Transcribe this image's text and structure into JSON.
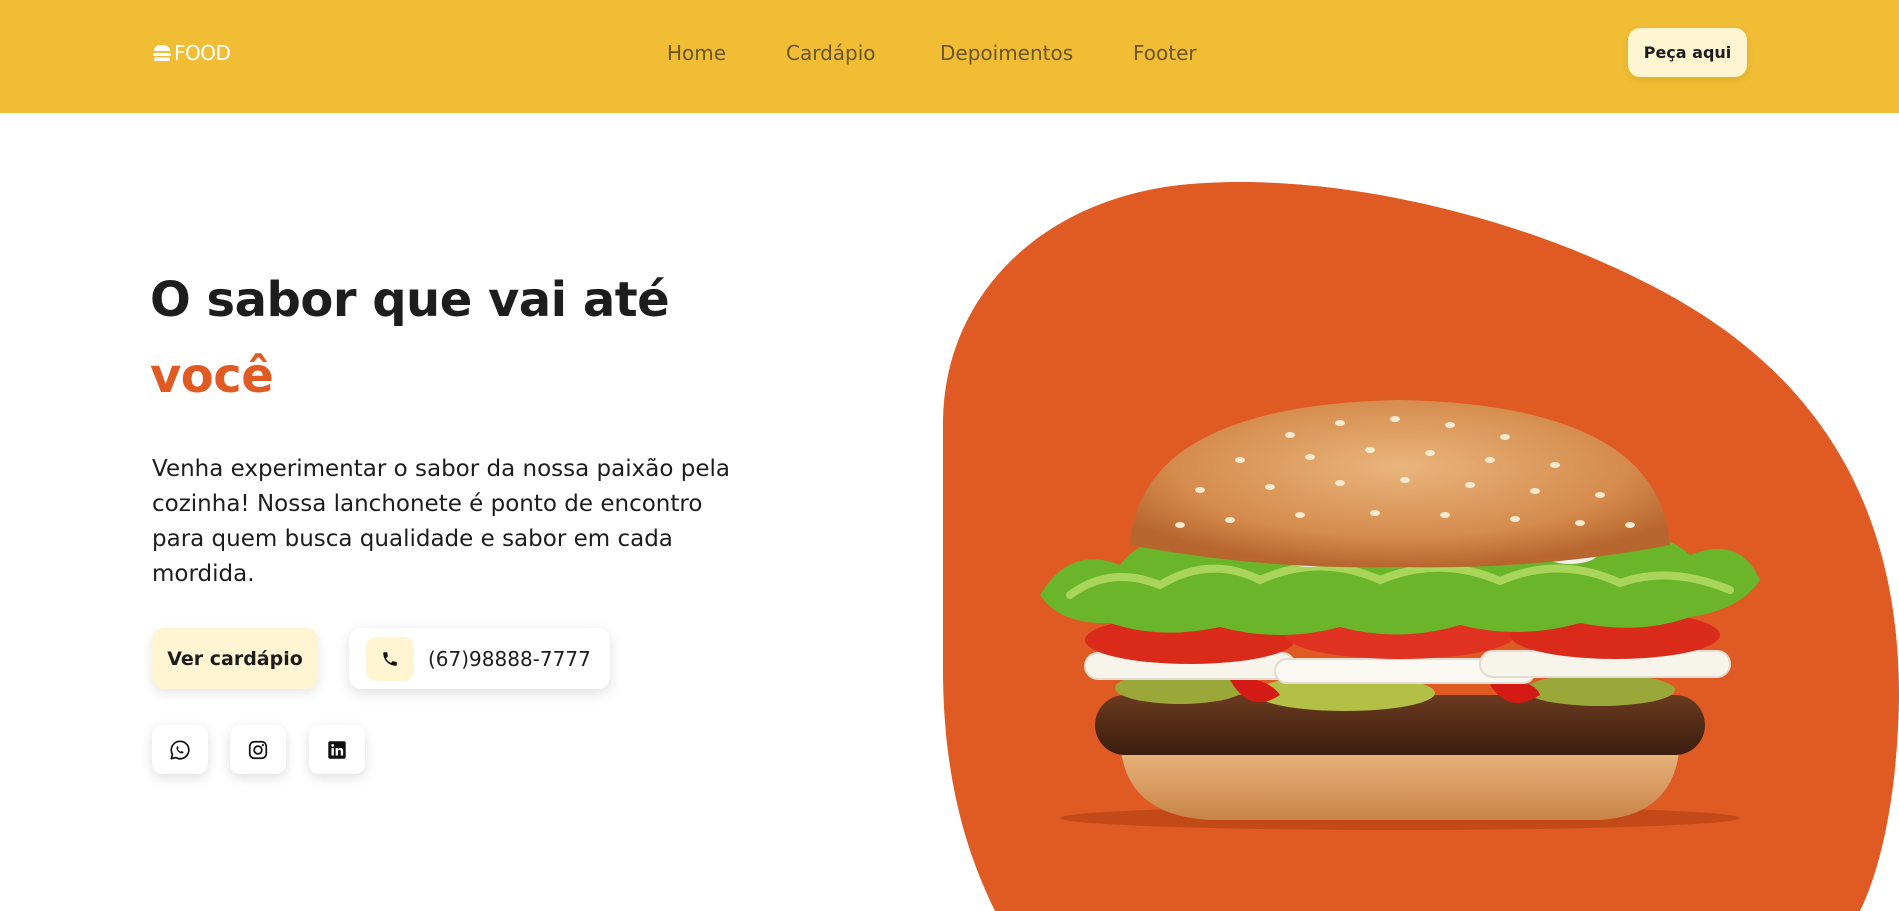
{
  "colors": {
    "header_bg": "#f0bd34",
    "accent": "#e05a24",
    "cream": "#fff5d3",
    "text": "#1d1d1d",
    "nav_text": "#6b5626"
  },
  "header": {
    "logo_text": "FOOD",
    "logo_icon": "burger-icon",
    "nav": [
      {
        "label": "Home"
      },
      {
        "label": "Cardápio"
      },
      {
        "label": "Depoimentos"
      },
      {
        "label": "Footer"
      }
    ],
    "cta_label": "Peça aqui"
  },
  "hero": {
    "title_line1": "O sabor que vai até",
    "title_accent": "você",
    "description": "Venha experimentar o sabor da nossa paixão pela cozinha! Nossa lanchonete é ponto de encontro para quem busca qualidade e sabor em cada mordida.",
    "menu_button_label": "Ver cardápio",
    "phone_icon": "phone-icon",
    "phone_number": "(67)98888-7777",
    "social": [
      {
        "icon": "whatsapp-icon"
      },
      {
        "icon": "instagram-icon"
      },
      {
        "icon": "linkedin-icon"
      }
    ],
    "image": "hamburger-photo"
  }
}
